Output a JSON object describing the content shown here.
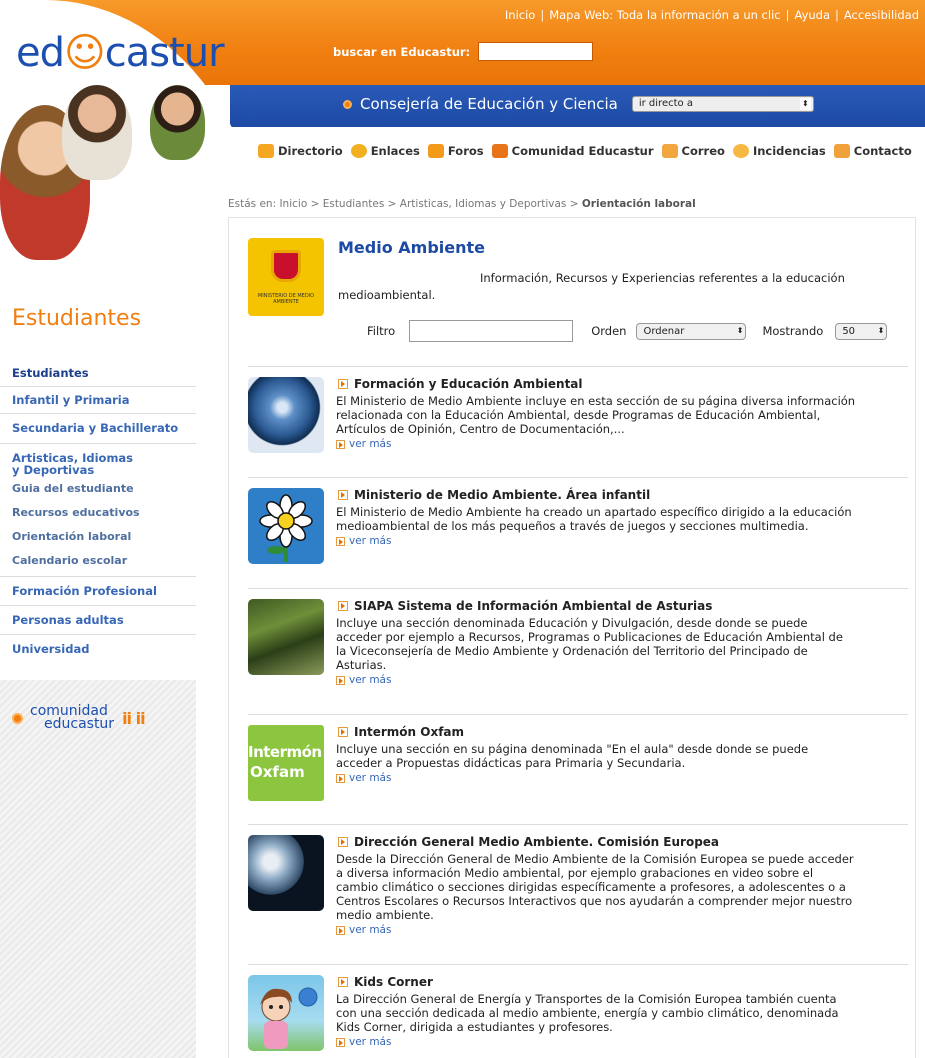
{
  "header": {
    "logo_prefix": "ed",
    "logo_smile": "☺",
    "logo_suffix": "castur",
    "top_links": [
      "Inicio",
      "Mapa Web: Toda la información a un clic",
      "Ayuda",
      "Accesibilidad"
    ],
    "search_label": "buscar en Educastur:",
    "search_value": "",
    "consejeria": "Consejería de Educación y Ciencia",
    "direct_select": "ir directo a",
    "nav": [
      "Directorio",
      "Enlaces",
      "Foros",
      "Comunidad Educastur",
      "Correo",
      "Incidencias",
      "Contacto"
    ]
  },
  "sidebar": {
    "section_title": "Estudiantes",
    "items": {
      "estudiantes": "Estudiantes",
      "infantil": "Infantil y Primaria",
      "secundaria": "Secundaria y Bachillerato",
      "artisticas": "Artisticas, Idiomas y Deportivas",
      "guia": "Guia del estudiante",
      "recursos": "Recursos educativos",
      "orientacion": "Orientación laboral",
      "calendario": "Calendario escolar",
      "fp": "Formación Profesional",
      "adultas": "Personas adultas",
      "universidad": "Universidad"
    },
    "comunidad_l1": "comunidad",
    "comunidad_l2": "educastur",
    "comunidad_people": "ii ii"
  },
  "breadcrumb": {
    "prefix": "Estás en: Inicio > Estudiantes > Artisticas, Idiomas y Deportivas > ",
    "current": "Orientación laboral"
  },
  "main": {
    "logo_text": "MINISTERIO DE MEDIO AMBIENTE",
    "title": "Medio Ambiente",
    "description": "Información, Recursos y Experiencias referentes a la educación medioambiental.",
    "filter_label": "Filtro",
    "filter_value": "",
    "order_label": "Orden",
    "order_value": "Ordenar",
    "showing_label": "Mostrando",
    "showing_value": "50"
  },
  "resources": {
    "r0": {
      "title": "Formación y Educación Ambiental",
      "desc": "El Ministerio de Medio Ambiente incluye en esta sección de su página diversa información relacionada con la Educación Ambiental, desde Programas de Educación Ambiental, Artículos de Opinión, Centro de Documentación,...",
      "more": "ver más",
      "thumb": "earth-image"
    },
    "r1": {
      "title": "Ministerio de Medio Ambiente. Área infantil",
      "desc": "El Ministerio de Medio Ambiente ha creado un apartado específico dirigido a la educación medioambiental de los más pequeños a través de juegos y secciones multimedia.",
      "more": "ver más",
      "thumb": "daisy-image"
    },
    "r2": {
      "title": "SIAPA Sistema de Información Ambiental de Asturias",
      "desc": "Incluye una sección denominada Educación y Divulgación, desde donde se puede acceder por ejemplo a Recursos, Programas o Publicaciones de Educación Ambiental de la Viceconsejería de Medio Ambiente y Ordenación del Territorio del Principado de Asturias.",
      "more": "ver más",
      "thumb": "forest-image"
    },
    "r3": {
      "title": "Intermón Oxfam",
      "desc": "Incluye una sección en su página denominada \"En el aula\" desde donde se puede acceder a Propuestas didácticas para Primaria y Secundaria.",
      "more": "ver más",
      "thumb_l1": "Intermón",
      "thumb_l2": "Oxfam"
    },
    "r4": {
      "title": "Dirección General Medio Ambiente. Comisión Europea",
      "desc": "Desde la Dirección General de Medio Ambiente de la Comisión Europea se puede acceder a diversa información Medio ambiental, por ejemplo grabaciones en video sobre el cambio climático o secciones dirigidas específicamente a profesores, a adolescentes o a Centros Escolares o Recursos Interactivos que nos ayudarán a comprender mejor nuestro medio ambiente.",
      "more": "ver más",
      "thumb": "planet-image"
    },
    "r5": {
      "title": "Kids Corner",
      "desc": "La Dirección General de Energía y Transportes de la Comisión Europea también cuenta con una sección dedicada al medio ambiente, energía y cambio climático, denominada Kids Corner, dirigida a estudiantes y profesores.",
      "more": "ver más",
      "thumb": "kids-cartoon-image"
    }
  },
  "colors": {
    "orange": "#f07f10",
    "blue": "#1c4aa5",
    "link": "#3867b5"
  }
}
